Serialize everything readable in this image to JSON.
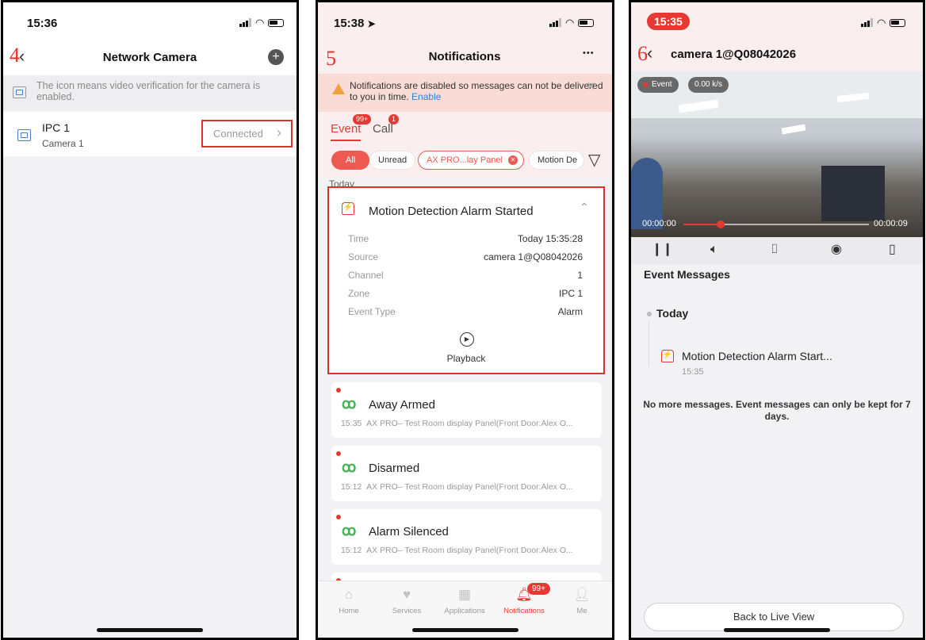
{
  "screen1": {
    "step": "4",
    "time": "15:36",
    "title": "Network Camera",
    "info_text": "The icon means video verification for the camera is enabled.",
    "device": {
      "name": "IPC 1",
      "sub": "Camera 1",
      "status": "Connected"
    }
  },
  "screen2": {
    "step": "5",
    "time": "15:38",
    "title": "Notifications",
    "more": "•••",
    "warning": {
      "text": "Notifications are disabled so messages can not be delivered to you in time.",
      "link": "Enable"
    },
    "tabs": [
      {
        "label": "Event",
        "badge": "99+"
      },
      {
        "label": "Call",
        "badge": "1"
      }
    ],
    "filters": {
      "all": "All",
      "unread": "Unread",
      "panel": "AX PRO...lay Panel",
      "motion": "Motion De"
    },
    "section": "Today",
    "expanded_event": {
      "title": "Motion Detection Alarm Started",
      "rows": [
        {
          "label": "Time",
          "value": "Today 15:35:28"
        },
        {
          "label": "Source",
          "value": "camera 1@Q08042026"
        },
        {
          "label": "Channel",
          "value": "1"
        },
        {
          "label": "Zone",
          "value": "IPC 1"
        },
        {
          "label": "Event Type",
          "value": "Alarm"
        }
      ],
      "playback": "Playback"
    },
    "events": [
      {
        "title": "Away Armed",
        "time": "15:35",
        "desc": "AX PRO– Test Room display Panel(Front Door:Alex O..."
      },
      {
        "title": "Disarmed",
        "time": "15:12",
        "desc": "AX PRO– Test Room display Panel(Front Door:Alex O..."
      },
      {
        "title": "Alarm Silenced",
        "time": "15:12",
        "desc": "AX PRO– Test Room display Panel(Front Door:Alex O..."
      }
    ],
    "tabbar": {
      "home": "Home",
      "services": "Services",
      "applications": "Applications",
      "notifications": "Notifications",
      "notifications_badge": "99+",
      "me": "Me"
    }
  },
  "screen3": {
    "step": "6",
    "time": "15:35",
    "title": "camera 1@Q08042026",
    "video": {
      "event_tag": "Event",
      "rate": "0.00 k/s",
      "start": "00:00:00",
      "end": "00:00:09",
      "progress": 0.2
    },
    "section_title": "Event Messages",
    "today": "Today",
    "message": {
      "title": "Motion Detection Alarm Start...",
      "time": "15:35"
    },
    "footer_note": "No more messages. Event messages can only be kept for 7 days.",
    "button": "Back to Live View"
  },
  "colors": {
    "accent_red": "#e53a33",
    "link_blue": "#2f7fd8",
    "green": "#3fb34f",
    "warning_bg": "#f9dcd6"
  }
}
